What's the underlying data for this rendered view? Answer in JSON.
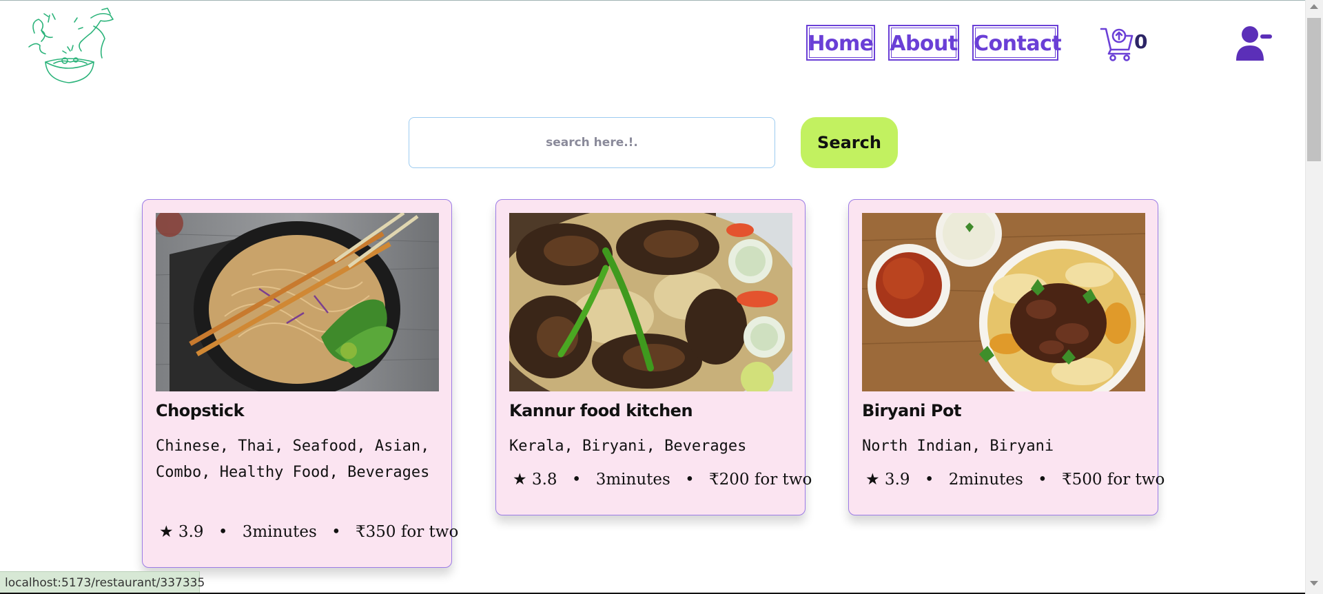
{
  "nav": {
    "links": [
      "Home",
      "About",
      "Contact"
    ],
    "cart_count": "0"
  },
  "search": {
    "placeholder": "search here.!.",
    "button_label": "Search"
  },
  "restaurants": [
    {
      "name": "Chopstick",
      "cuisines": "Chinese, Thai, Seafood, Asian, Combo, Healthy Food, Beverages",
      "rating": "★ 3.9",
      "time": "3minutes",
      "cost": "₹350 for two",
      "image_icon": "noodles-bowl-photo"
    },
    {
      "name": "Kannur food kitchen",
      "cuisines": "Kerala, Biryani, Beverages",
      "rating": "★ 3.8",
      "time": "3minutes",
      "cost": "₹200 for two",
      "image_icon": "grilled-chicken-rice-photo"
    },
    {
      "name": "Biryani Pot",
      "cuisines": "North Indian, Biryani",
      "rating": "★ 3.9",
      "time": "2minutes",
      "cost": "₹500 for two",
      "image_icon": "biryani-plate-photo"
    }
  ],
  "meta_separator": "•",
  "status_bar": {
    "url": "localhost:5173/restaurant/337335"
  },
  "colors": {
    "nav_accent": "#6a3fd6",
    "search_button": "#c2f160",
    "card_background": "#fbe4f1",
    "card_border": "#9b7be6",
    "logo_green": "#2bb37a",
    "user_icon": "#5b2fb8"
  }
}
